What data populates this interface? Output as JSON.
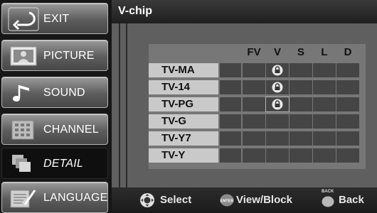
{
  "sidebar": {
    "items": [
      {
        "label": "EXIT",
        "icon": "exit-arrow-icon"
      },
      {
        "label": "PICTURE",
        "icon": "picture-icon"
      },
      {
        "label": "SOUND",
        "icon": "music-note-icon"
      },
      {
        "label": "CHANNEL",
        "icon": "channel-grid-icon"
      },
      {
        "label": "DETAIL",
        "icon": "detail-pages-icon",
        "active": true
      },
      {
        "label": "LANGUAGE",
        "icon": "language-document-icon"
      }
    ]
  },
  "title": "V-chip",
  "columns": [
    "FV",
    "V",
    "S",
    "L",
    "D"
  ],
  "ratings": [
    "TV-MA",
    "TV-14",
    "TV-PG",
    "TV-G",
    "TV-Y7",
    "TV-Y"
  ],
  "locks": [
    {
      "row": "TV-MA",
      "column": "V"
    },
    {
      "row": "TV-14",
      "column": "V"
    },
    {
      "row": "TV-PG",
      "column": "V",
      "selected": true
    }
  ],
  "footer": {
    "select_label": "Select",
    "enter_key": "ENTER",
    "viewblock_label": "View/Block",
    "back_key": "BACK",
    "back_label": "Back"
  },
  "colors": {
    "panel": "#5f5f5f",
    "rating_cell": "#c9c9c9",
    "grid_cell": "#454545"
  }
}
